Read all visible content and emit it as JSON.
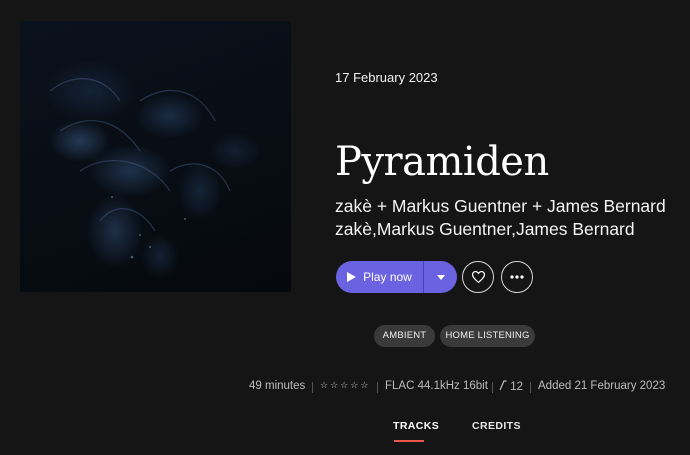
{
  "album": {
    "release_date": "17 February 2023",
    "title": "Pyramiden",
    "artist_credit": "zakè + Markus Guentner + James Bernard",
    "artists": [
      "zakè",
      "Markus Guentner",
      "James Bernard"
    ]
  },
  "actions": {
    "play_label": "Play now",
    "play_icon": "play-icon",
    "dropdown_icon": "caret-down-icon",
    "favorite_icon": "heart-icon",
    "more_icon": "more-icon"
  },
  "tags": [
    "AMBIENT",
    "HOME LISTENING"
  ],
  "meta": {
    "duration": "49 minutes",
    "rating_stars": 5,
    "rating_value": 0,
    "format": "FLAC 44.1kHz 16bit",
    "track_count": "12",
    "track_icon": "music-note-icon",
    "added": "Added 21 February 2023"
  },
  "tabs": [
    {
      "label": "TRACKS",
      "active": true
    },
    {
      "label": "CREDITS",
      "active": false
    }
  ],
  "colors": {
    "background": "#151515",
    "accent": "#6a62e0",
    "tab_underline": "#e9574a",
    "tag_bg": "#3a3a3a"
  }
}
